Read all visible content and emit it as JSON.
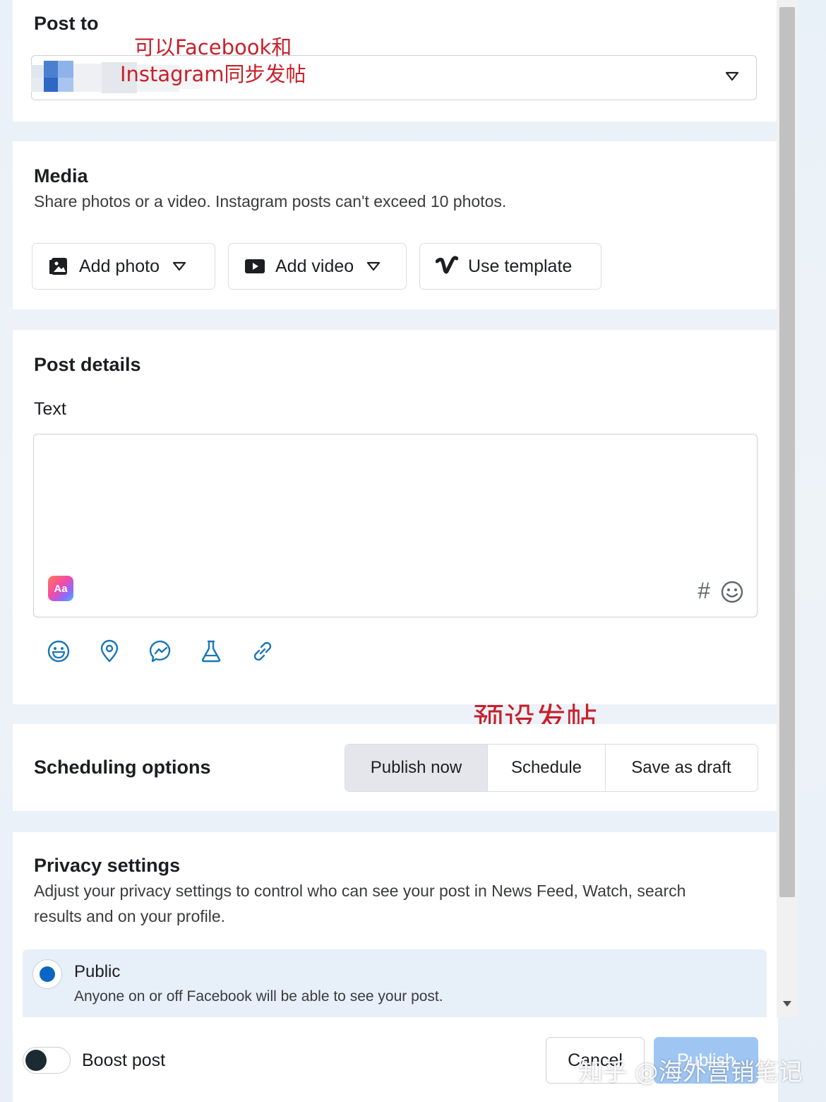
{
  "post_to": {
    "title": "Post to",
    "annotation_line1": "可以Facebook和",
    "annotation_line2": "Instagram同步发帖"
  },
  "media": {
    "title": "Media",
    "description": "Share photos or a video. Instagram posts can't exceed 10 photos.",
    "buttons": {
      "add_photo": "Add photo",
      "add_video": "Add video",
      "use_template": "Use template"
    }
  },
  "post_details": {
    "title": "Post details",
    "text_label": "Text",
    "text_value": "",
    "aa_badge": "Aa",
    "hashtag_symbol": "#"
  },
  "scheduling": {
    "annotation": "预设发帖",
    "title": "Scheduling options",
    "options": [
      "Publish now",
      "Schedule",
      "Save as draft"
    ],
    "selected": "Publish now"
  },
  "privacy": {
    "title": "Privacy settings",
    "description_line1": "Adjust your privacy settings to control who can see your post in News Feed, Watch, search",
    "description_line2": "results and on your profile.",
    "public_label": "Public",
    "public_description": "Anyone on or off Facebook will be able to see your post.",
    "public_selected": true
  },
  "footer": {
    "boost_label": "Boost post",
    "boost_on": false,
    "cancel_label": "Cancel",
    "publish_label": "Publish"
  },
  "watermark": "知乎 @海外营销笔记",
  "colors": {
    "accent_blue": "#0a66c2",
    "annotation_red": "#c8202a",
    "tool_icon_blue": "#1877b7"
  }
}
